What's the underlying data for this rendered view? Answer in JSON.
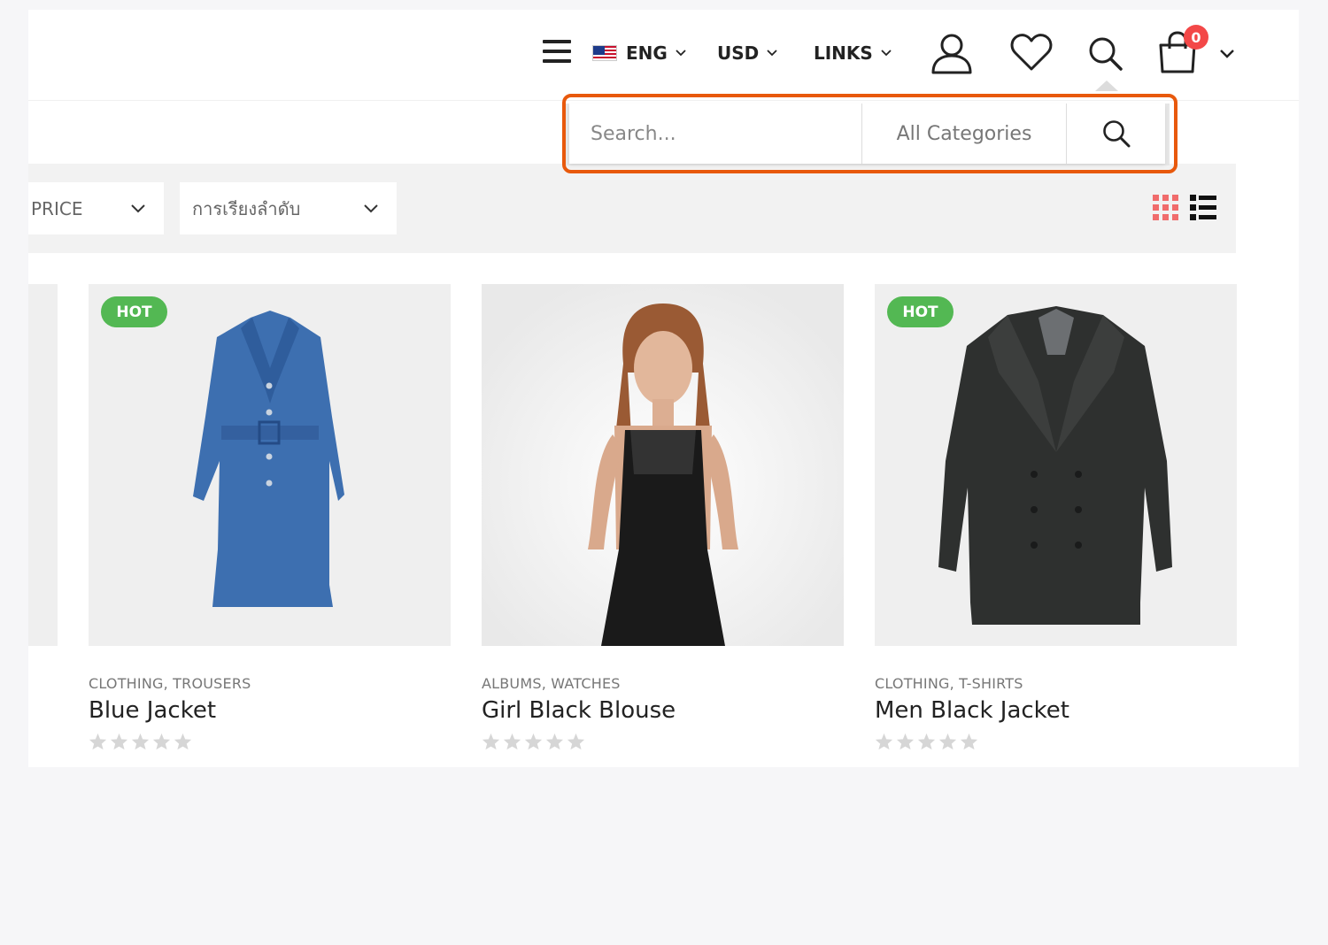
{
  "header": {
    "language": "ENG",
    "currency": "USD",
    "links": "LINKS",
    "cart_count": "0"
  },
  "search": {
    "placeholder": "Search...",
    "category": "All Categories"
  },
  "toolbar": {
    "filter_price": "PRICE",
    "sort_label": "การเรียงลำดับ"
  },
  "products": [
    {
      "badge": "HOT",
      "categories": "CLOTHING, TROUSERS",
      "name": "Blue Jacket",
      "rating": 0
    },
    {
      "badge": "",
      "categories": "ALBUMS, WATCHES",
      "name": "Girl Black Blouse",
      "rating": 0
    },
    {
      "badge": "HOT",
      "categories": "CLOTHING, T-SHIRTS",
      "name": "Men Black Jacket",
      "rating": 0
    }
  ],
  "colors": {
    "accent": "#e8590c",
    "badge_hot": "#53b853",
    "cart_badge": "#f34848",
    "grid_icon": "#f06c6c"
  },
  "icons": [
    "menu-icon",
    "us-flag-icon",
    "user-icon",
    "heart-icon",
    "search-icon",
    "cart-icon",
    "grid-view-icon",
    "list-view-icon",
    "star-icon"
  ]
}
